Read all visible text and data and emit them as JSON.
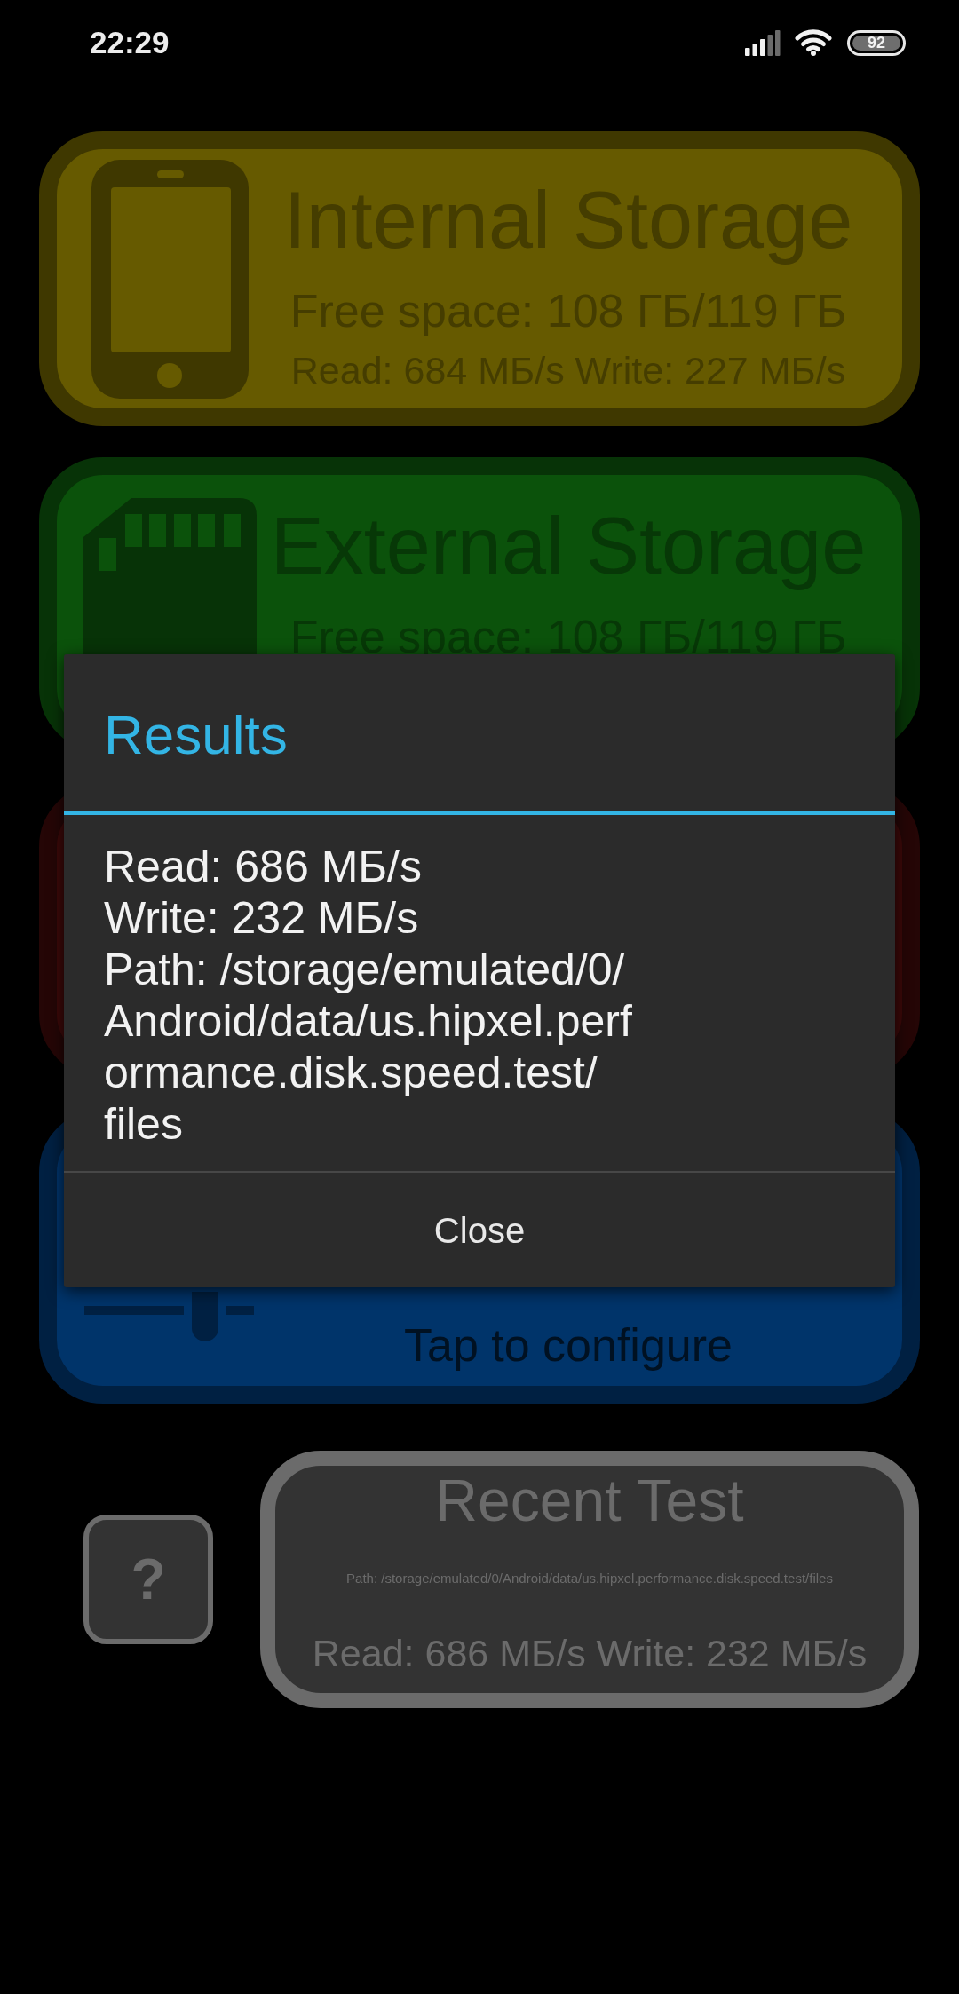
{
  "status_bar": {
    "time": "22:29",
    "battery": "92"
  },
  "cards": [
    {
      "kind": "phone",
      "color": "#665a00",
      "title": "Internal Storage",
      "lines": [
        {
          "kind": "free_space",
          "text": "Free space: 108 ГБ/119 ГБ"
        },
        {
          "kind": "speeds",
          "text": "Read: 684 МБ/s Write: 227 МБ/s"
        }
      ]
    },
    {
      "kind": "sdcard",
      "color": "#0b520b",
      "title": "External Storage",
      "lines": [
        {
          "kind": "free_space",
          "text": "Free space: 108 ГБ/119 ГБ"
        }
      ]
    },
    {
      "kind": "plain",
      "color": "#3c0909"
    },
    {
      "kind": "sliders",
      "color": "#00346a",
      "lines": [
        {
          "kind": "hint",
          "text": "Tap to configure"
        }
      ]
    }
  ],
  "help_button": {
    "label": "?"
  },
  "recent_test": {
    "title": "Recent Test",
    "path": "Path: /storage/emulated/0/Android/data/us.hipxel.performance.disk.speed.test/files",
    "speeds": "Read: 686 МБ/s Write: 232 МБ/s"
  },
  "dialog": {
    "title": "Results",
    "lines": [
      "Read: 686 МБ/s",
      "Write: 232 МБ/s",
      "Path: /storage/emulated/0/\nAndroid/data/us.hipxel.perf\normance.disk.speed.test/\nfiles"
    ],
    "button": "Close"
  }
}
